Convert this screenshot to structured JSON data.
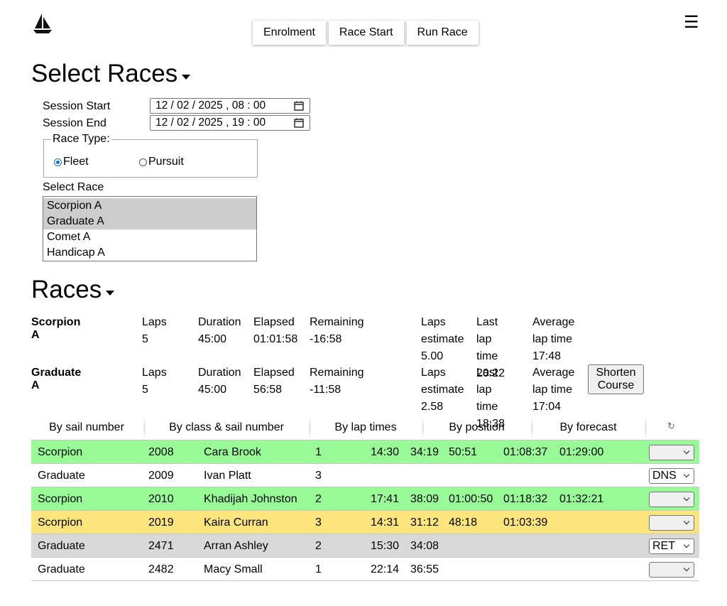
{
  "nav": {
    "items": [
      {
        "label": "Enrolment"
      },
      {
        "label": "Race Start"
      },
      {
        "label": "Run Race"
      }
    ]
  },
  "select_races": {
    "title": "Select Races",
    "session_start_label": "Session Start",
    "session_start_value": "12 / 02 / 2025 ,  08 : 00",
    "session_end_label": "Session End",
    "session_end_value": "12 / 02 / 2025 ,  19 : 00",
    "race_type_label": "Race Type:",
    "race_type_options": [
      {
        "label": "Fleet",
        "checked": true
      },
      {
        "label": "Pursuit",
        "checked": false
      }
    ],
    "select_race_label": "Select Race",
    "races": [
      {
        "label": "Scorpion A",
        "selected": true
      },
      {
        "label": "Graduate A",
        "selected": true
      },
      {
        "label": "Comet A",
        "selected": false
      },
      {
        "label": "Handicap A",
        "selected": false
      }
    ]
  },
  "races": {
    "title": "Races",
    "blocks": [
      {
        "name": "Scorpion A",
        "laps_label": "Laps",
        "laps": "5",
        "duration_label": "Duration",
        "duration": "45:00",
        "elapsed_label": "Elapsed",
        "elapsed": "01:01:58",
        "remaining_label": "Remaining",
        "remaining": "-16:58",
        "laps_estimate_label_1": "Laps",
        "laps_estimate_label_2": "estimate",
        "laps_estimate": "5.00",
        "last_lap_label_1": "Last lap",
        "last_lap_label_2": "time",
        "last_lap": "20:22",
        "avg_lap_label_1": "Average",
        "avg_lap_label_2": "lap time",
        "avg_lap": "17:48"
      },
      {
        "name": "Graduate A",
        "laps_label": "Laps",
        "laps": "5",
        "duration_label": "Duration",
        "duration": "45:00",
        "elapsed_label": "Elapsed",
        "elapsed": "56:58",
        "remaining_label": "Remaining",
        "remaining": "-11:58",
        "laps_estimate_label_1": "Laps",
        "laps_estimate_label_2": "estimate",
        "laps_estimate": "2.58",
        "last_lap_label_1": "Last lap",
        "last_lap_label_2": "time",
        "last_lap": "18:38",
        "avg_lap_label_1": "Average",
        "avg_lap_label_2": "lap time",
        "avg_lap": "17:04"
      }
    ],
    "shorten_course_line1": "Shorten",
    "shorten_course_line2": "Course",
    "tabs": [
      {
        "label": "By sail number"
      },
      {
        "label": "By class & sail number"
      },
      {
        "label": "By lap times"
      },
      {
        "label": "By position"
      },
      {
        "label": "By forecast"
      }
    ],
    "refresh_icon": "↻",
    "entries": [
      {
        "cls": "Scorpion",
        "sail": "2008",
        "helm": "Cara Brook",
        "laps": "1",
        "times": [
          "14:30",
          "34:19",
          "50:51",
          "01:08:37",
          "01:29:00"
        ],
        "status": "",
        "color": "green"
      },
      {
        "cls": "Graduate",
        "sail": "2009",
        "helm": "Ivan Platt",
        "laps": "3",
        "times": [],
        "status": "DNS",
        "color": "white"
      },
      {
        "cls": "Scorpion",
        "sail": "2010",
        "helm": "Khadijah Johnston",
        "laps": "2",
        "times": [
          "17:41",
          "38:09",
          "01:00:50",
          "01:18:32",
          "01:32:21"
        ],
        "status": "",
        "color": "green"
      },
      {
        "cls": "Scorpion",
        "sail": "2019",
        "helm": "Kaira Curran",
        "laps": "3",
        "times": [
          "14:31",
          "31:12",
          "48:18",
          "01:03:39"
        ],
        "status": "",
        "color": "yellow"
      },
      {
        "cls": "Graduate",
        "sail": "2471",
        "helm": "Arran Ashley",
        "laps": "2",
        "times": [
          "15:30",
          "34:08"
        ],
        "status": "RET",
        "color": "grey"
      },
      {
        "cls": "Graduate",
        "sail": "2482",
        "helm": "Macy Small",
        "laps": "1",
        "times": [
          "22:14",
          "36:55"
        ],
        "status": "",
        "color": "white"
      }
    ]
  }
}
